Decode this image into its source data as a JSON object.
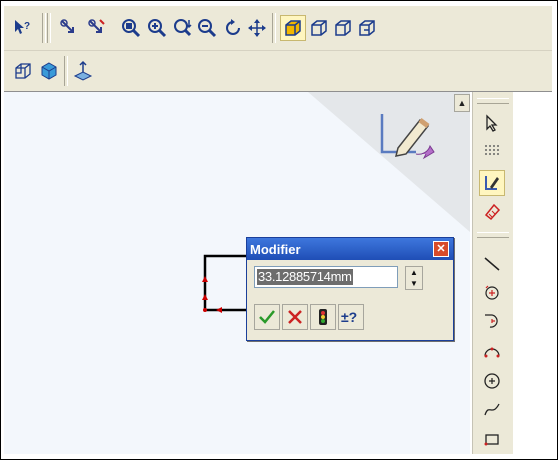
{
  "toolbar_top": {
    "row1_icons": [
      "whats-this-icon",
      "select-icon",
      "multi-select-icon",
      "zoom-fit-icon",
      "zoom-in-icon",
      "zoom-area-icon",
      "zoom-out-icon",
      "rotate-icon",
      "pan-icon",
      "view-iso-icon",
      "view-front-icon",
      "view-right-icon",
      "view-top-icon"
    ],
    "row2_icons": [
      "view-wire-icon",
      "shaded-icon",
      "plane-icon"
    ]
  },
  "sketch_toolbar": {
    "icons": [
      "select-arrow-icon",
      "grid-icon",
      "sketch-icon",
      "smart-dimension-icon",
      "line-icon",
      "center-rectangle-icon",
      "tangent-arc-icon",
      "threepoint-arc-icon",
      "circle-icon",
      "spline-icon",
      "rectangle-icon"
    ]
  },
  "modifier_dialog": {
    "title": "Modifier",
    "value": "33.12885714mm",
    "accent": "#3e77dd"
  },
  "colors": {
    "canvas": "#f3f7fc",
    "toolbar": "#ece9d8",
    "sketch_line": "#000000",
    "endpoint": "#cc0000"
  }
}
